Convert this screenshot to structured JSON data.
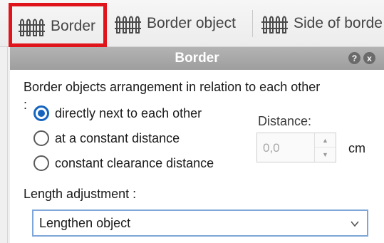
{
  "toolbar": {
    "buttons": [
      {
        "label": "Border",
        "icon": "fence-icon",
        "active": true
      },
      {
        "label": "Border object",
        "icon": "fence-icon"
      },
      {
        "label": "Side of borde",
        "icon": "fence-icon"
      }
    ],
    "highlight_color": "#e0151b"
  },
  "panel": {
    "title": "Border",
    "help_icon": "?",
    "close_icon": "x"
  },
  "arrangement": {
    "label": "Border objects arrangement in relation to each other",
    "colon": ":",
    "options": [
      {
        "label": "directly next to each other",
        "checked": true
      },
      {
        "label": "at a constant distance",
        "checked": false
      },
      {
        "label": "constant clearance distance",
        "checked": false
      }
    ]
  },
  "distance": {
    "label": "Distance:",
    "value": "0,0",
    "unit": "cm"
  },
  "length_adjustment": {
    "label": "Length adjustment :",
    "selected": "Lengthen object"
  }
}
